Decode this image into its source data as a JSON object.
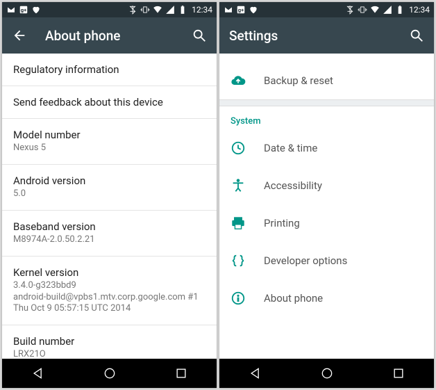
{
  "status": {
    "time": "12:34"
  },
  "left": {
    "title": "About phone",
    "rows": [
      {
        "primary": "Regulatory information"
      },
      {
        "primary": "Send feedback about this device"
      },
      {
        "primary": "Model number",
        "secondary": "Nexus 5"
      },
      {
        "primary": "Android version",
        "secondary": "5.0"
      },
      {
        "primary": "Baseband version",
        "secondary": "M8974A-2.0.50.2.21"
      },
      {
        "primary": "Kernel version",
        "secondary": "3.4.0-g323bbd9\nandroid-build@vpbs1.mtv.corp.google.com #1\nThu Oct 9 05:57:15 UTC 2014"
      },
      {
        "primary": "Build number",
        "secondary": "LRX21O"
      }
    ]
  },
  "right": {
    "title": "Settings",
    "backup_reset": "Backup & reset",
    "section": "System",
    "items": [
      {
        "label": "Date & time"
      },
      {
        "label": "Accessibility"
      },
      {
        "label": "Printing"
      },
      {
        "label": "Developer options"
      },
      {
        "label": "About phone"
      }
    ]
  }
}
